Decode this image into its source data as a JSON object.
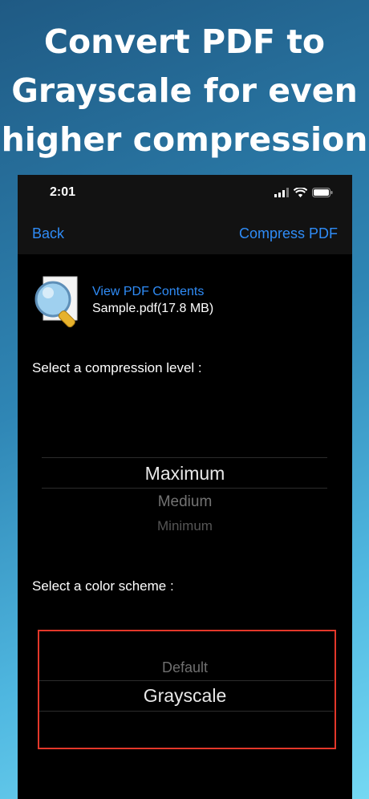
{
  "headline": {
    "line1": "Convert PDF to",
    "line2": "Grayscale for even",
    "line3": "higher compression"
  },
  "status_bar": {
    "time": "2:01",
    "icons": [
      "cellular-signal-icon",
      "wifi-icon",
      "battery-icon"
    ]
  },
  "nav": {
    "back_label": "Back",
    "action_label": "Compress PDF"
  },
  "file": {
    "icon": "pdf-magnifier-icon",
    "view_label": "View PDF Contents",
    "info": "Sample.pdf(17.8 MB)"
  },
  "compression": {
    "label": "Select a compression level :",
    "selected": "Maximum",
    "options": [
      "Maximum",
      "Medium",
      "Minimum"
    ]
  },
  "color_scheme": {
    "label": "Select a color scheme :",
    "selected": "Grayscale",
    "options": [
      "Default",
      "Grayscale"
    ]
  },
  "colors": {
    "accent": "#2f8cf7",
    "highlight": "#e3372a",
    "background_top": "#1f5a84",
    "background_bottom": "#74d8f3"
  }
}
